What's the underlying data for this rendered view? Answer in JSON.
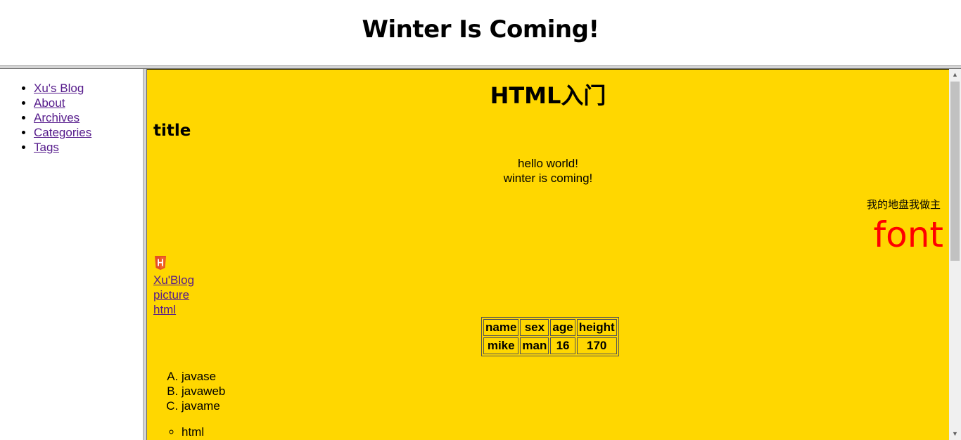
{
  "header": {
    "title": "Winter Is Coming!"
  },
  "sidebar": {
    "items": [
      {
        "label": "Xu's Blog"
      },
      {
        "label": "About"
      },
      {
        "label": "Archives"
      },
      {
        "label": "Categories"
      },
      {
        "label": "Tags"
      }
    ]
  },
  "main": {
    "heading": "HTML入门",
    "subheading": "title",
    "center_lines": [
      "hello world!",
      "winter is coming!"
    ],
    "right_small": "我的地盘我做主",
    "right_font": "font",
    "icon": "html5-icon",
    "links": [
      "Xu'Blog",
      "picture",
      "html"
    ],
    "table": {
      "headers": [
        "name",
        "sex",
        "age",
        "height"
      ],
      "rows": [
        [
          "mike",
          "man",
          "16",
          "170"
        ]
      ]
    },
    "ordered_list": [
      "javase",
      "javaweb",
      "javame"
    ],
    "unordered_list": [
      "html"
    ]
  },
  "colors": {
    "main_background": "#ffd700",
    "font_text": "#ff0000",
    "visited_link": "#551a8b"
  },
  "scrollbar": {
    "up_icon": "scroll-up-arrow-icon",
    "down_icon": "scroll-down-arrow-icon"
  }
}
